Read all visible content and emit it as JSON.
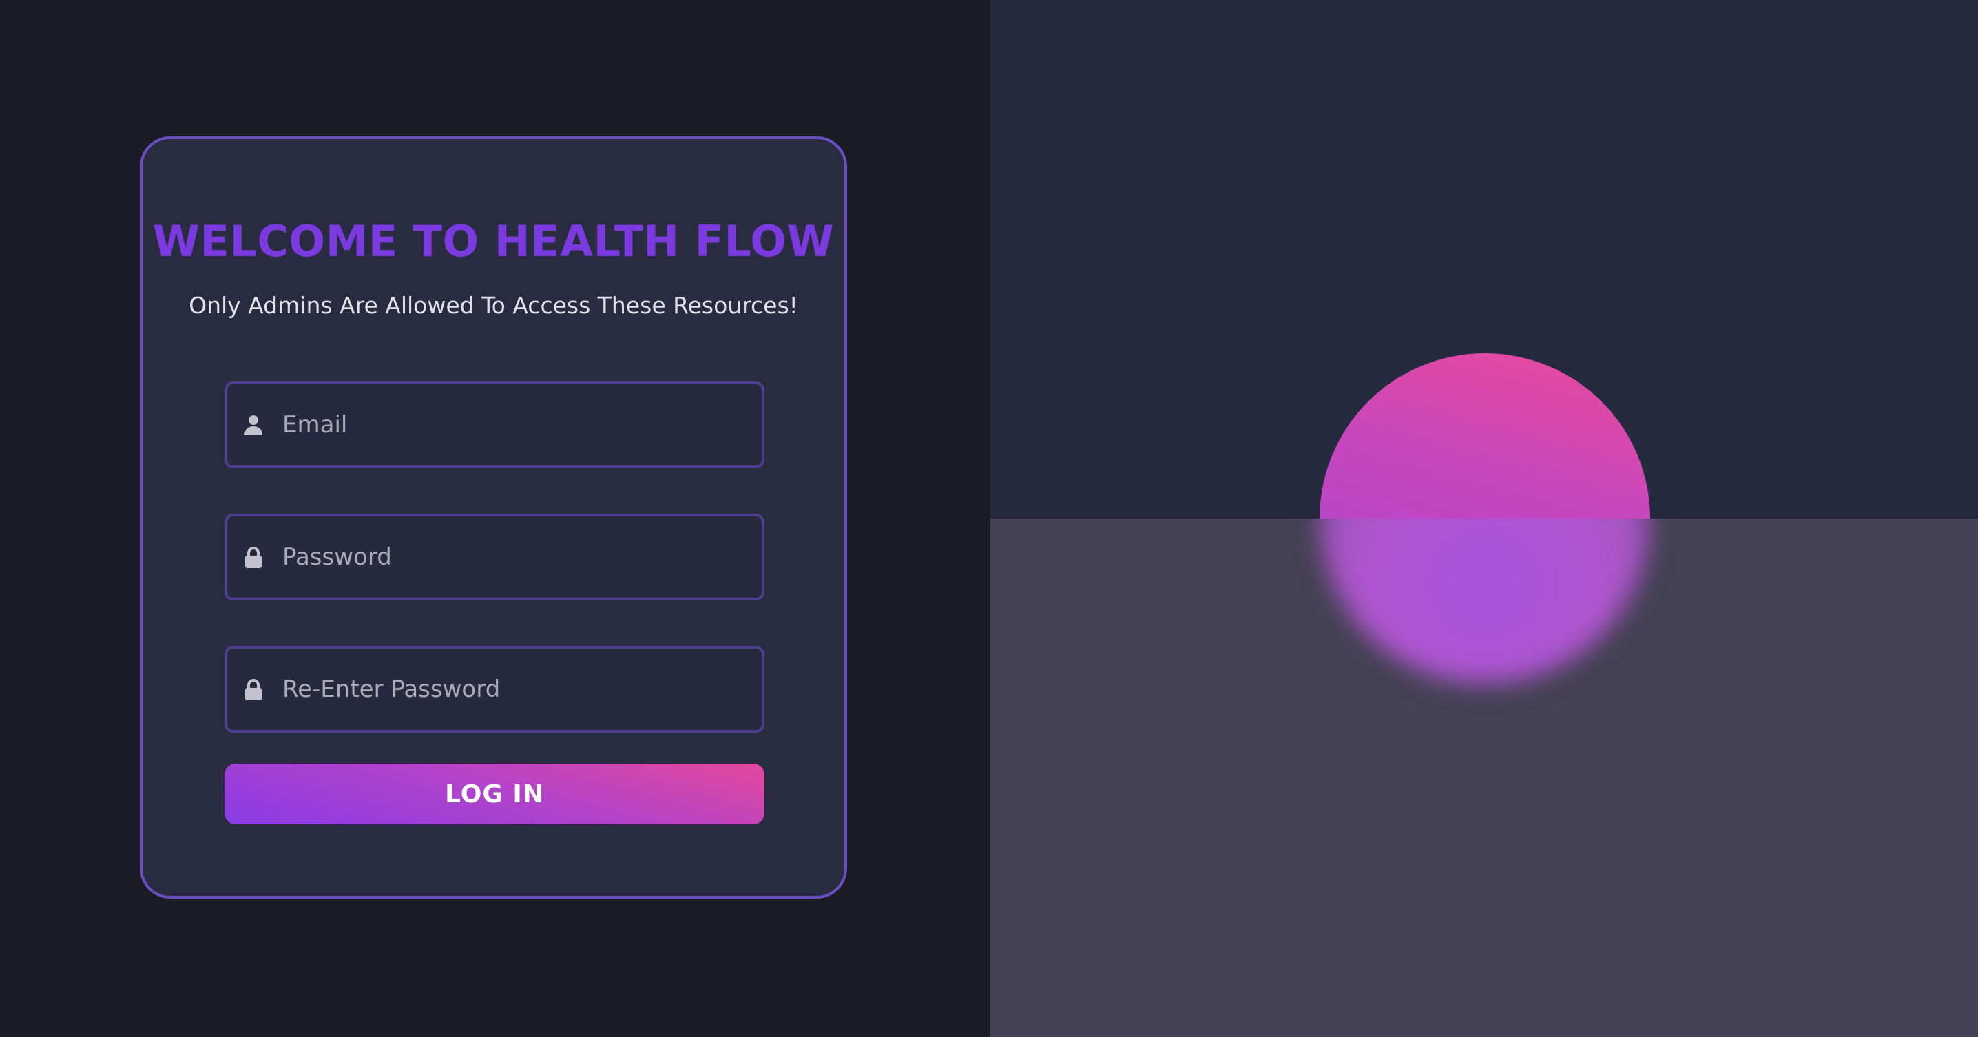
{
  "login": {
    "title": "WELCOME TO HEALTH FLOW",
    "subtitle": "Only Admins Are Allowed To Access These Resources!",
    "fields": {
      "email": {
        "placeholder": "Email",
        "icon": "user-icon"
      },
      "password": {
        "placeholder": "Password",
        "icon": "lock-icon"
      },
      "confirm_password": {
        "placeholder": "Re-Enter Password",
        "icon": "lock-icon"
      }
    },
    "button_label": "LOG IN"
  },
  "colors": {
    "accent": "#7a3ae0",
    "accent_gradient_start": "#8a3be6",
    "accent_gradient_end": "#e4489c",
    "card_border": "#6b4fc2",
    "subtitle_text": "#e2e2ea",
    "icon": "#c2c2cc"
  }
}
